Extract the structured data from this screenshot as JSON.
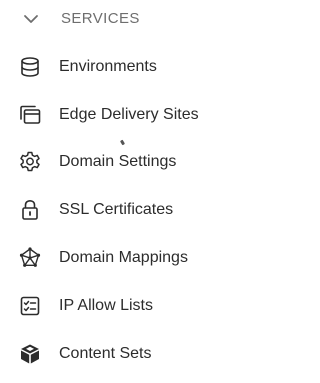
{
  "section": {
    "title": "SERVICES",
    "chevron_icon": "chevron-down-icon"
  },
  "items": [
    {
      "label": "Environments",
      "icon": "database-icon"
    },
    {
      "label": "Edge Delivery Sites",
      "icon": "stacked-windows-icon"
    },
    {
      "label": "Domain Settings",
      "icon": "gear-icon"
    },
    {
      "label": "SSL Certificates",
      "icon": "lock-icon"
    },
    {
      "label": "Domain Mappings",
      "icon": "network-star-icon"
    },
    {
      "label": "IP Allow Lists",
      "icon": "checklist-icon"
    },
    {
      "label": "Content Sets",
      "icon": "cube-icon"
    }
  ],
  "colors": {
    "text": "#2c2c2c",
    "header_text": "#6e6e6e",
    "background": "#ffffff"
  }
}
